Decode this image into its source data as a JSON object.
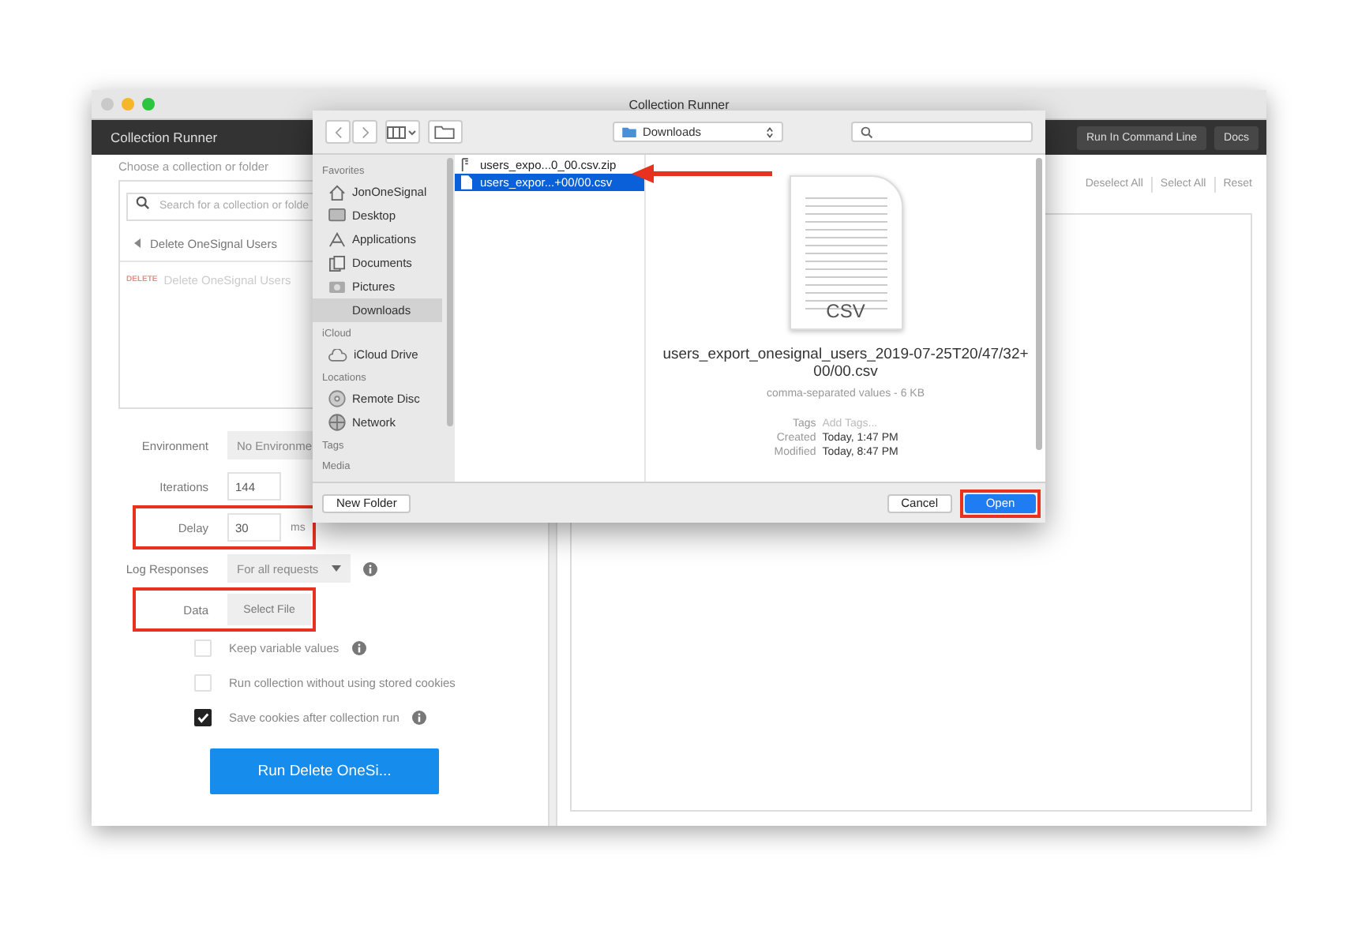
{
  "window": {
    "title": "Collection Runner"
  },
  "header": {
    "title": "Collection Runner",
    "buttons": [
      "Run In Command Line",
      "Docs"
    ]
  },
  "collection_picker": {
    "label": "Choose a collection or folder",
    "search": {
      "placeholder": "Search for a collection or folde"
    },
    "breadcrumb": "Delete OneSignal Users",
    "items": [
      {
        "method": "DELETE",
        "name": "Delete OneSignal Users"
      }
    ]
  },
  "settings": [
    {
      "kind": "select",
      "label": "Environment",
      "value": "No Environme",
      "highlighted": false,
      "info": false
    },
    {
      "kind": "input",
      "label": "Iterations",
      "value": "144",
      "highlighted": false,
      "info": false
    },
    {
      "kind": "input",
      "label": "Delay",
      "value": "30",
      "unit": "ms",
      "highlighted": true,
      "info": false
    },
    {
      "kind": "select",
      "label": "Log Responses",
      "value": "For all requests",
      "highlighted": false,
      "info": true
    },
    {
      "kind": "button",
      "label": "Data",
      "value": "Select File",
      "highlighted": true,
      "info": false
    }
  ],
  "options": [
    {
      "label": "Keep variable values",
      "checked": false,
      "info": true
    },
    {
      "label": "Run collection without using stored cookies",
      "checked": false,
      "info": false
    },
    {
      "label": "Save cookies after collection run",
      "checked": true,
      "info": true
    }
  ],
  "run_button": "Run Delete OneSi...",
  "results": {
    "actions": [
      "Deselect All",
      "Select All",
      "Reset"
    ]
  },
  "file_dialog": {
    "location": "Downloads",
    "sidebar": [
      {
        "heading": "Favorites",
        "items": [
          {
            "label": "JonOneSignal",
            "selected": false
          },
          {
            "label": "Desktop",
            "selected": false
          },
          {
            "label": "Applications",
            "selected": false
          },
          {
            "label": "Documents",
            "selected": false
          },
          {
            "label": "Pictures",
            "selected": false
          },
          {
            "label": "Downloads",
            "selected": true
          }
        ]
      },
      {
        "heading": "iCloud",
        "items": [
          {
            "label": "iCloud Drive",
            "selected": false
          }
        ]
      },
      {
        "heading": "Locations",
        "items": [
          {
            "label": "Remote Disc",
            "selected": false
          },
          {
            "label": "Network",
            "selected": false
          }
        ]
      },
      {
        "heading": "Tags"
      },
      {
        "heading": "Media"
      }
    ],
    "files": [
      {
        "name": "users_expo...0_00.csv.zip",
        "kind": "zip",
        "selected": false
      },
      {
        "name": "users_expor...+00/00.csv",
        "kind": "document",
        "selected": true
      }
    ],
    "preview": {
      "icon_label": "CSV",
      "name": "users_export_onesignal_users_2019-07-25T20/47/32+00/00.csv",
      "info": "comma-separated values - 6 KB",
      "details": [
        {
          "label": "Tags",
          "placeholder": "Add Tags...",
          "kind": "field"
        },
        {
          "label": "Created",
          "value": "Today, 1:47 PM",
          "kind": "text"
        },
        {
          "label": "Modified",
          "value": "Today, 8:47 PM",
          "kind": "text"
        }
      ]
    },
    "new_folder_button": "New Folder",
    "cancel_button": "Cancel",
    "open_button": {
      "label": "Open",
      "highlighted": true
    }
  }
}
